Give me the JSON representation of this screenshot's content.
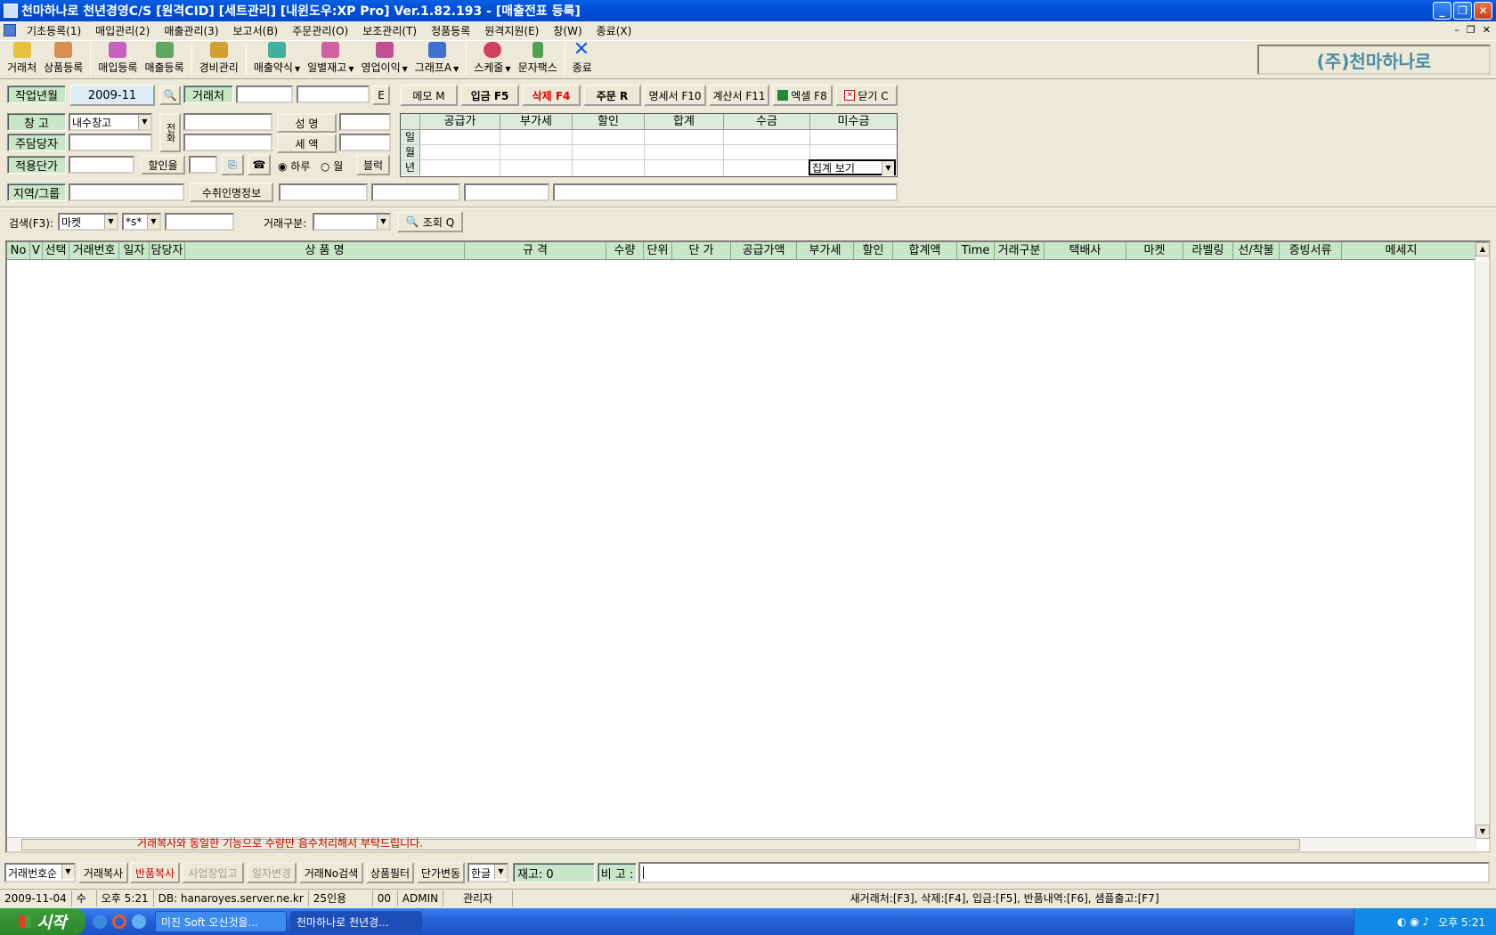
{
  "window": {
    "title": "천마하나로 천년경영C/S [원격CID] [세트관리] [내윈도우:XP Pro] Ver.1.82.193 - [매출전표 등록]"
  },
  "menu": [
    "기초등록(1)",
    "매입관리(2)",
    "매출관리(3)",
    "보고서(B)",
    "주문관리(O)",
    "보조관리(T)",
    "정품등록",
    "원격지원(E)",
    "창(W)",
    "종료(X)"
  ],
  "toolbar": {
    "items": [
      "거래처",
      "상품등록",
      "매입등록",
      "매출등록",
      "경비관리",
      "매출약식",
      "일별재고",
      "영업이익",
      "그래프A",
      "스케줄",
      "문자팩스",
      "종료"
    ],
    "company": "(주)천마하나로"
  },
  "form": {
    "work_month_label": "작업년월",
    "work_month": "2009-11",
    "customer_label": "거래처",
    "e_btn": "E",
    "warehouse_label": "창 고",
    "warehouse_value": "내수창고",
    "phone_label": "전화",
    "name_btn": "성 명",
    "tax_btn": "세 액",
    "manager_label": "주담당자",
    "price_label": "적용단가",
    "discount_label": "할인율",
    "radio_day": "하루",
    "radio_month": "월",
    "block_btn": "블럭",
    "region_label": "지역/그룹",
    "receiver_btn": "수취인명정보"
  },
  "actions": [
    "메모 M",
    "입금 F5",
    "삭제 F4",
    "주문 R",
    "명세서 F10",
    "계산서 F11",
    "엑셀 F8",
    "닫기 C"
  ],
  "summary": {
    "headers": [
      "공급가",
      "부가세",
      "할인",
      "합계",
      "수금",
      "미수금"
    ],
    "rows": [
      "일",
      "월",
      "년"
    ],
    "select": "집계 보기"
  },
  "search": {
    "label": "검색(F3):",
    "field": "마켓",
    "mode": "*s*",
    "type_label": "거래구분:",
    "query_btn": "조회 Q"
  },
  "grid": {
    "columns": [
      "No",
      "V",
      "선택",
      "거래번호",
      "일자",
      "담당자",
      "상 품 명",
      "규 격",
      "수량",
      "단위",
      "단 가",
      "공급가액",
      "부가세",
      "할인",
      "합계액",
      "Time",
      "거래구분",
      "택배사",
      "마켓",
      "라벨링",
      "선/착불",
      "증빙서류",
      "메세지"
    ],
    "message": "거래복사와 동일한 기능으로 수량만 음수처리해서 부탁드립니다."
  },
  "bottom": {
    "sort": "거래번호순",
    "buttons": [
      "거래복사",
      "반품복사",
      "사업장입고",
      "일자변경",
      "거래No검색",
      "상품필터",
      "단가변동"
    ],
    "lang": "한글",
    "stock": "재고: 0",
    "note_label": "비 고 :"
  },
  "status": {
    "date": "2009-11-04",
    "weekday": "수",
    "time": "오후 5:21",
    "db": "DB: hanaroyes.server.ne.kr",
    "users": "25인용",
    "code": "00",
    "user": "ADMIN",
    "role": "관리자",
    "shortcuts": "새거래처:[F3], 삭제:[F4], 입금:[F5], 반품내역:[F6], 샘플출고:[F7]"
  },
  "taskbar": {
    "start": "시작",
    "tasks": [
      "미진 Soft 오신것을...",
      "천마하나로 천년경..."
    ],
    "clock": "오후 5:21"
  },
  "colors": {
    "label_bg": "#c8e6c8",
    "delete_text": "#e00000",
    "title_bg": "#0050d8"
  }
}
